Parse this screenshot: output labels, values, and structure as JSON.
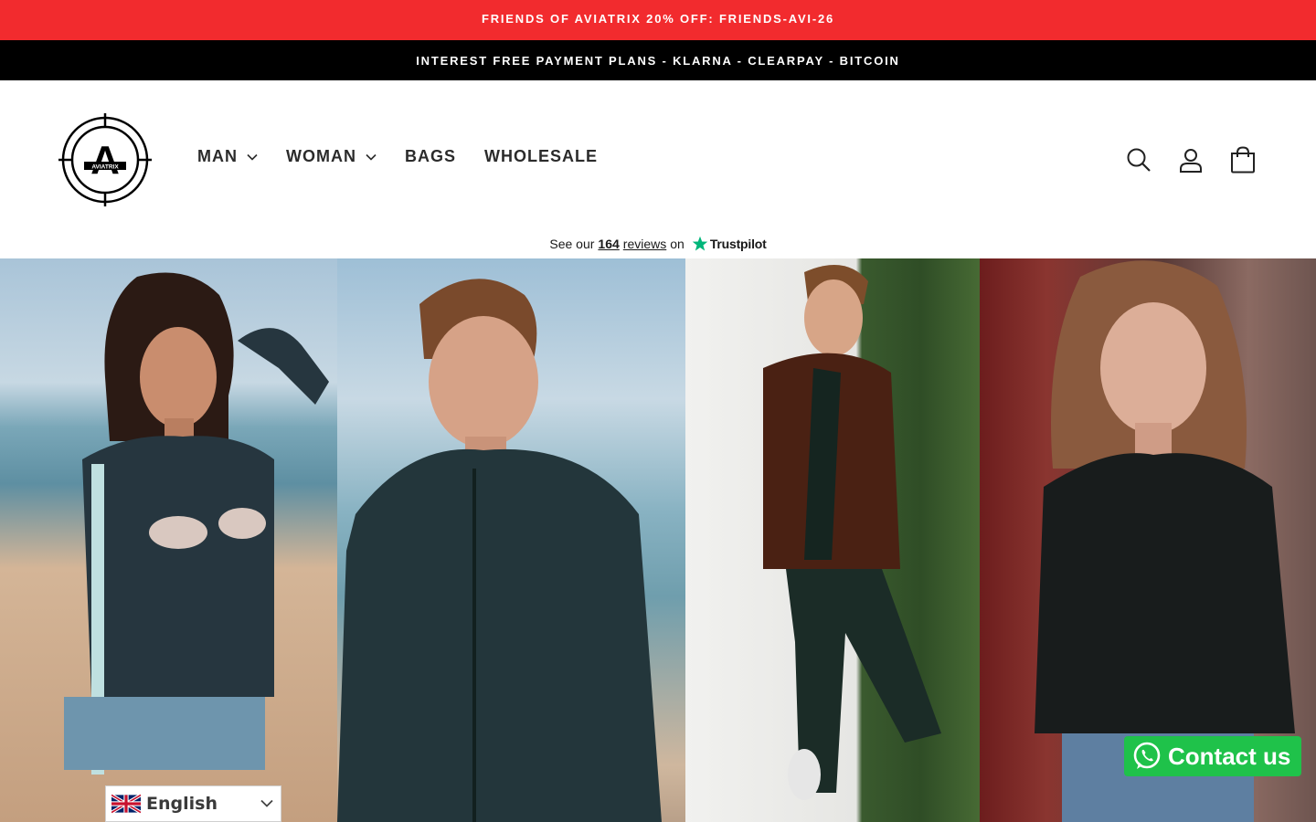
{
  "announcement": {
    "promo_text": "FRIENDS OF AVIATRIX 20% OFF: FRIENDS-AVI-26",
    "payment_text": "INTEREST FREE PAYMENT PLANS - KLARNA - CLEARPAY - BITCOIN"
  },
  "header": {
    "logo_text": "AVIATRIX",
    "logo_letter": "A",
    "nav": [
      {
        "label": "MAN",
        "has_dropdown": true
      },
      {
        "label": "WOMAN",
        "has_dropdown": true
      },
      {
        "label": "BAGS",
        "has_dropdown": false
      },
      {
        "label": "WHOLESALE",
        "has_dropdown": false
      }
    ],
    "icons": [
      "search-icon",
      "account-icon",
      "cart-icon"
    ]
  },
  "trustpilot": {
    "prefix": "See our",
    "count": "164",
    "reviews_word": "reviews",
    "on_word": "on",
    "brand": "Trustpilot"
  },
  "language_selector": {
    "selected": "English",
    "flag": "uk-flag-icon"
  },
  "contact_button": {
    "label": "Contact us",
    "icon": "whatsapp-icon"
  },
  "colors": {
    "promo_bar": "#f22b2e",
    "payment_bar": "#000000",
    "contact_green": "#1fc24a",
    "trustpilot_star": "#00b67a"
  }
}
